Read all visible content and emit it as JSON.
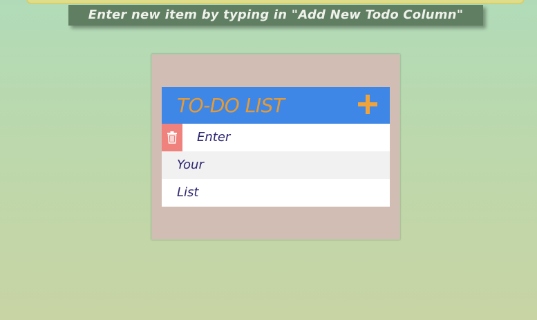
{
  "banner": {
    "text": "Enter new item by typing in \"Add New Todo Column\""
  },
  "todo": {
    "title": "TO-DO LIST",
    "add_icon": "plus-icon",
    "delete_icon": "trash-icon",
    "items": [
      {
        "text": "Enter"
      },
      {
        "text": "Your"
      },
      {
        "text": "List"
      }
    ]
  },
  "colors": {
    "header_bg": "#3f87e6",
    "title": "#e89a32",
    "delete_bg": "#f0827d",
    "item_text": "#2c2670",
    "card_bg": "#d2bdb5",
    "banner_bg": "#607e62"
  }
}
